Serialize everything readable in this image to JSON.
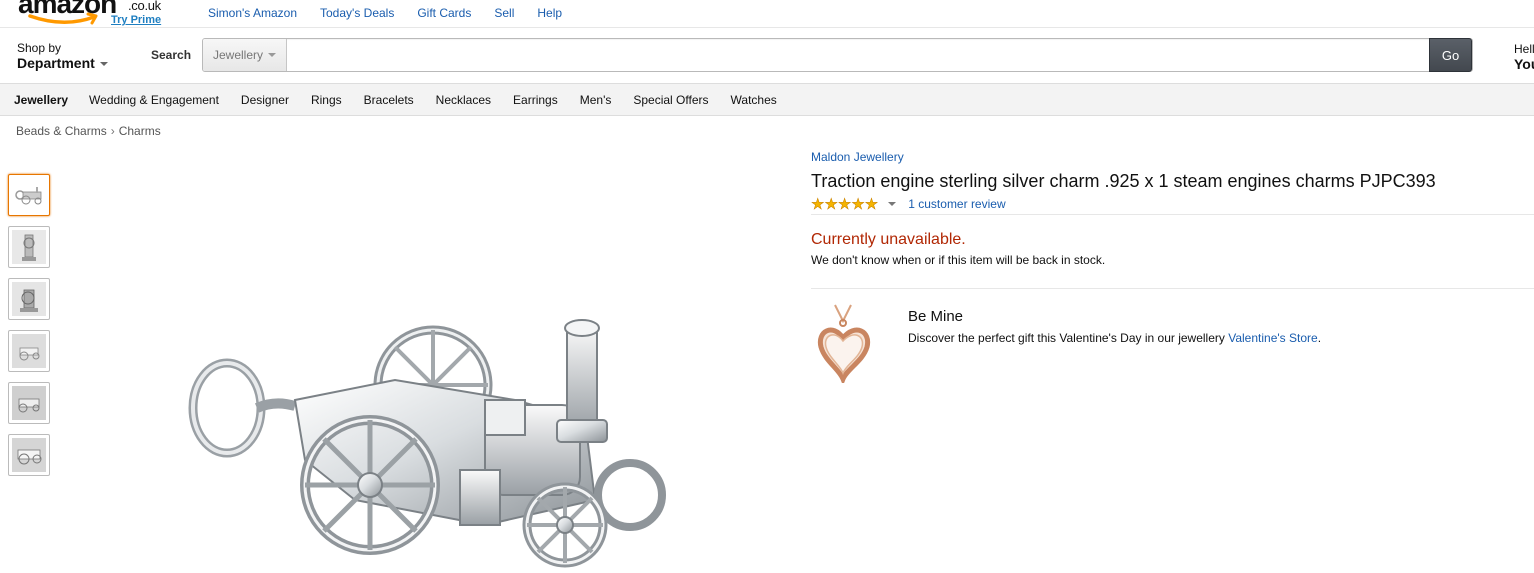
{
  "logo": {
    "word": "amazon",
    "tld": ".co.uk",
    "prime": "Try Prime"
  },
  "topnav": [
    "Simon's Amazon",
    "Today's Deals",
    "Gift Cards",
    "Sell",
    "Help"
  ],
  "search": {
    "dept_small": "Shop by",
    "dept_big": "Department",
    "label": "Search",
    "scope": "Jewellery",
    "query": "",
    "go": "Go"
  },
  "account": {
    "hello": "Hell",
    "your": "You"
  },
  "catnav": [
    "Jewellery",
    "Wedding & Engagement",
    "Designer",
    "Rings",
    "Bracelets",
    "Necklaces",
    "Earrings",
    "Men's",
    "Special Offers",
    "Watches"
  ],
  "breadcrumb": [
    "Beads & Charms",
    "Charms"
  ],
  "breadcrumb_sep": "›",
  "thumbnails_count": 6,
  "product": {
    "brand": "Maldon Jewellery",
    "title": "Traction engine sterling silver charm .925 x 1 steam engines charms PJPC393",
    "stars": "★★★★★",
    "rating_out_of_5": 5,
    "reviews": "1 customer review",
    "availability": "Currently unavailable.",
    "availability_sub": "We don't know when or if this item will be back in stock."
  },
  "promo": {
    "title": "Be Mine",
    "text": "Discover the perfect gift this Valentine's Day in our jewellery ",
    "link": "Valentine's Store",
    "suffix": "."
  },
  "colors": {
    "link": "#1a5dae",
    "unavailable": "#b12704",
    "star": "#f5b400",
    "active_thumb": "#e77600",
    "go_button": "#4b5158"
  }
}
